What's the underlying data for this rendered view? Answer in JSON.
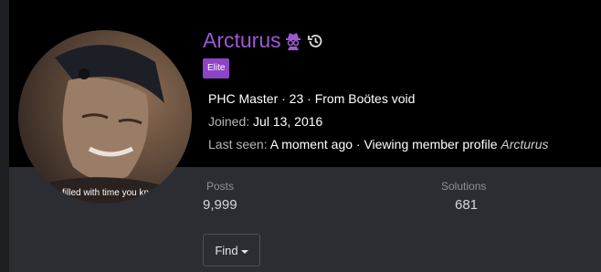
{
  "profile": {
    "username": "Arcturus",
    "badge": "Elite",
    "headline": "PHC Master · 23 · From Boötes void",
    "joined_label": "Joined:",
    "joined_value": "Jul 13, 2016",
    "last_seen_label": "Last seen:",
    "last_seen_value": "A moment ago · Viewing member profile",
    "last_seen_target": "Arcturus",
    "avatar_caption": "filled with time you kn"
  },
  "stats": {
    "posts_label": "Posts",
    "posts_value": "9,999",
    "solutions_label": "Solutions",
    "solutions_value": "681"
  },
  "actions": {
    "find_label": "Find"
  },
  "icons": {
    "spy": "spy-icon",
    "history": "history-icon",
    "caret": "caret-down-icon"
  },
  "colors": {
    "username": "#9b59d0",
    "badge_bg": "#8e44c6",
    "banner_bg": "#000000",
    "page_bg": "#2b2d33"
  }
}
